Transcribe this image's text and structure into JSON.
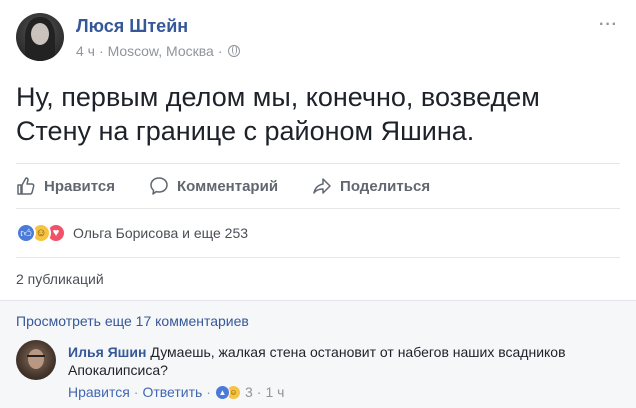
{
  "post": {
    "author": "Люся Штейн",
    "time": "4 ч",
    "location": "Moscow, Москва",
    "text": "Ну, первым делом мы, конечно, возведем Стену на границе с районом Яшина.",
    "privacy_icon": "globe-icon",
    "menu_icon": "···"
  },
  "actions": {
    "like": "Нравится",
    "comment": "Комментарий",
    "share": "Поделиться"
  },
  "reactions": {
    "summary": "Ольга Борисова и еще 253",
    "types": [
      "like",
      "haha",
      "love"
    ]
  },
  "shares": {
    "label": "2 публикаций"
  },
  "comments": {
    "view_more": "Просмотреть еще 17 комментариев",
    "items": [
      {
        "author": "Илья Яшин",
        "text": "Думаешь, жалкая стена остановит от набегов наших всадников Апокалипсиса?",
        "like_label": "Нравится",
        "reply_label": "Ответить",
        "reaction_count": "3",
        "time": "1 ч"
      }
    ]
  },
  "colors": {
    "link": "#365899",
    "meta": "#90949c",
    "action": "#616770",
    "like_reaction": "#4b7bd9",
    "haha_reaction": "#f7c343",
    "love_reaction": "#f25268"
  }
}
